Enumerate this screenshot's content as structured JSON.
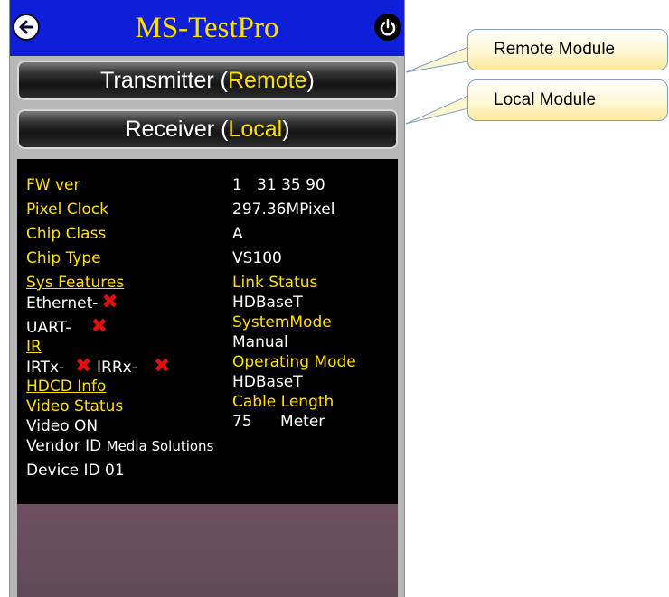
{
  "header": {
    "title": "MS-TestPro"
  },
  "buttons": {
    "transmitter": {
      "label": "Transmitter",
      "role": "Remote"
    },
    "receiver": {
      "label": "Receiver",
      "role": "Local"
    }
  },
  "info_left": {
    "fw_ver": "FW ver",
    "pixel_clock": "Pixel Clock",
    "chip_class": "Chip Class",
    "chip_type": "Chip Type",
    "sys_features": "Sys Features",
    "ethernet": "Ethernet-",
    "uart": "UART-",
    "ir": "IR",
    "irtx": "IRTx-",
    "irrx": "IRRx-",
    "hdcd_info": "HDCD Info",
    "video_status": "Video Status",
    "video_on": "Video ON",
    "vendor_label": "Vendor ID",
    "vendor_value": "Media Solutions",
    "device_id": "Device ID 01"
  },
  "info_right": {
    "fw_value": "1   31 35 90",
    "pixel_clock_value": "297.36MPixel",
    "chip_class_value": "A",
    "chip_type_value": "VS100",
    "link_status": "Link Status",
    "link_status_value": "HDBaseT",
    "system_mode": "SystemMode",
    "system_mode_value": "Manual",
    "operating_mode": "Operating Mode",
    "operating_mode_value": "HDBaseT",
    "cable_length": "Cable Length",
    "cable_length_value": "75",
    "cable_length_unit": "Meter"
  },
  "callouts": {
    "remote": "Remote Module",
    "local": "Local Module"
  },
  "colors": {
    "header_bg": "#0f1ed8",
    "accent_yellow": "#ffe000",
    "error_red": "#e01010"
  },
  "icons": [
    "back-arrow-icon",
    "power-icon",
    "x-mark-icon"
  ]
}
